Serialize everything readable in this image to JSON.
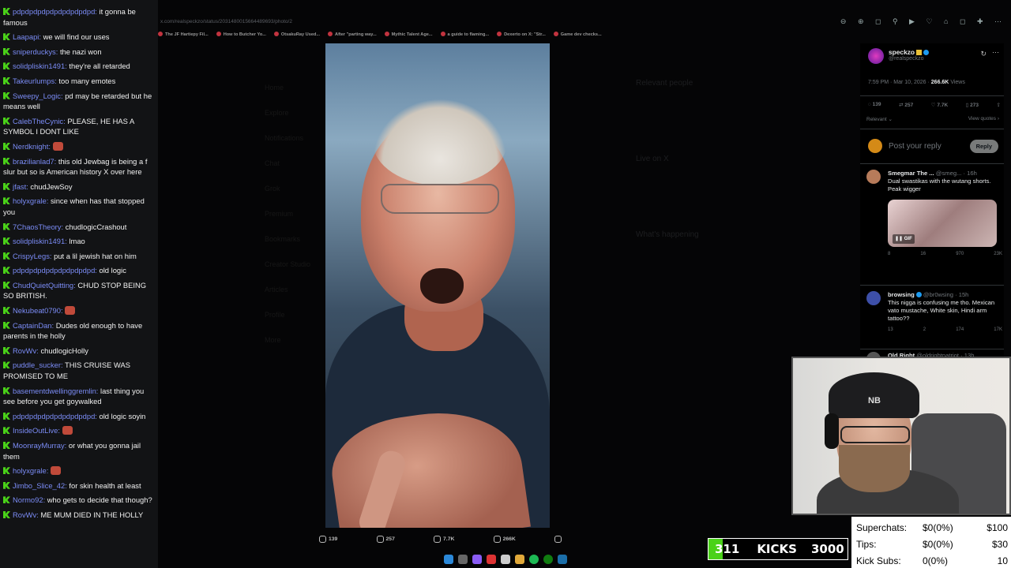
{
  "chat": [
    {
      "user": "pdpdpdpdpdpdpdpdpdpd",
      "text": "it gonna be famous"
    },
    {
      "user": "Laapapi",
      "text": "we will find our uses"
    },
    {
      "user": "sniperduckys",
      "text": "the nazi won"
    },
    {
      "user": "solidpliskin1491",
      "text": "they're all retarded"
    },
    {
      "user": "Takeurlumps",
      "text": "too many emotes"
    },
    {
      "user": "Sweepy_Logic",
      "text": "pd may be retarded but he means well"
    },
    {
      "user": "CalebTheCynic",
      "text": "PLEASE, HE HAS A SYMBOL I DONT LIKE"
    },
    {
      "user": "Nerdknight",
      "text": "",
      "emote": true
    },
    {
      "user": "brazilianlad7",
      "text": "this old Jewbag is being a f slur but so is American history X over here"
    },
    {
      "user": "jfast",
      "text": "chudJewSoy"
    },
    {
      "user": "holyxgrale",
      "text": "since when has that stopped you"
    },
    {
      "user": "7ChaosTheory",
      "text": "chudlogicCrashout"
    },
    {
      "user": "solidpliskin1491",
      "text": "lmao"
    },
    {
      "user": "CrispyLegs",
      "text": "put a lil jewish hat on him"
    },
    {
      "user": "pdpdpdpdpdpdpdpdpdpd",
      "text": "old logic"
    },
    {
      "user": "ChudQuietQuitting",
      "text": "CHUD STOP BEING SO BRITISH."
    },
    {
      "user": "Nekubeat0790",
      "text": "",
      "emote": true
    },
    {
      "user": "CaptainDan",
      "text": "Dudes old enough to have parents in the holly"
    },
    {
      "user": "RovWv",
      "text": "chudlogicHolly"
    },
    {
      "user": "puddle_sucker",
      "text": "THIS CRUISE WAS PROMISED TO ME"
    },
    {
      "user": "basementdwellinggremlin",
      "text": "last thing you see before you get goywalked"
    },
    {
      "user": "pdpdpdpdpdpdpdpdpdpd",
      "text": "old logic soyin"
    },
    {
      "user": "InsideOutLive",
      "text": "",
      "emote": true
    },
    {
      "user": "MoonrayMurray",
      "text": "or what you gonna jail them"
    },
    {
      "user": "holyxgrale",
      "text": "",
      "emote": true
    },
    {
      "user": "Jimbo_Slice_42",
      "text": "for skin health at least"
    },
    {
      "user": "Normo92",
      "text": "who gets to decide that though?"
    },
    {
      "user": "RovWv",
      "text": "ME MUM DIED IN THE HOLLY"
    }
  ],
  "browser": {
    "url": "x.com/realspeckzo/status/2031480015664489693/photo/2",
    "bookmarks": [
      "The JF Hartiepy Fil...",
      "How to Butcher Yo...",
      "OtsakuRay Used...",
      "After \"parting way...",
      "Mythic Talent Age...",
      "a guide to flaming...",
      "Dexerto on X: \"Str...",
      "Game dev checks..."
    ],
    "nav": [
      "Home",
      "Explore",
      "Notifications",
      "Chat",
      "Grok",
      "Premium",
      "Bookmarks",
      "Creator Studio",
      "Articles",
      "Profile",
      "More"
    ],
    "side": [
      "Relevant people",
      "Live on X",
      "What's happening"
    ]
  },
  "media_bar": {
    "replies": "139",
    "reposts": "257",
    "likes": "7.7K",
    "views": "266K"
  },
  "post": {
    "name": "speckzo",
    "handle": "@realspeckzo",
    "time": "7:59 PM · Mar 10, 2026 ·",
    "views_count": "266.6K",
    "views_label": "Views",
    "stats": [
      "139",
      "257",
      "7.7K",
      "273"
    ],
    "sort": "Relevant",
    "view_quotes": "View quotes",
    "reply_placeholder": "Post your reply",
    "reply_button": "Reply"
  },
  "replies": [
    {
      "name": "Smegmar The ...",
      "handle": "@smeg... · 16h",
      "text": "Dual swastikas with the wutang shorts. Peak wigger",
      "gif_label": "GIF",
      "stats": [
        "8",
        "16",
        "970",
        "23K"
      ],
      "color": "#b77b5a"
    },
    {
      "name": "browsing",
      "handle": "@br0wsing · 15h",
      "text": "This nigga is confusing me tho. Mexican vato mustache, White skin, Hindi arm tattoo??",
      "stats": [
        "13",
        "2",
        "174",
        "17K"
      ],
      "color": "#3d4fa8"
    },
    {
      "name": "Old Right",
      "handle": "@oldrightpatriot · 13h",
      "text": "",
      "stats": [],
      "color": "#555"
    }
  ],
  "kicks": {
    "count": "311",
    "label": "KICKS",
    "goal": "3000",
    "progress": 0.104,
    "color": "#4ad219"
  },
  "donations": [
    {
      "label": "Superchats:",
      "value": "$0(0%)",
      "goal": "$100"
    },
    {
      "label": "Tips:",
      "value": "$0(0%)",
      "goal": "$30"
    },
    {
      "label": "Kick Subs:",
      "value": "0(0%)",
      "goal": "10"
    }
  ]
}
